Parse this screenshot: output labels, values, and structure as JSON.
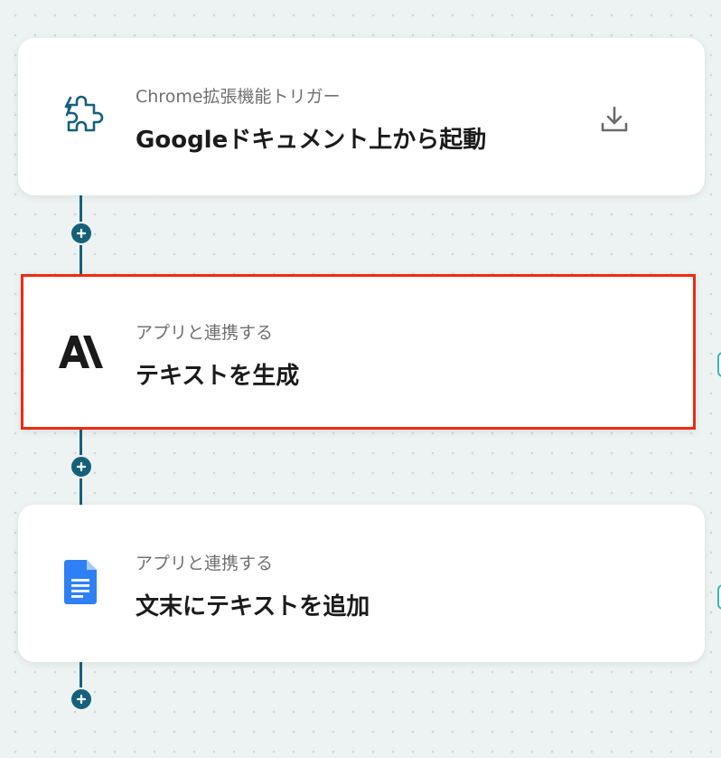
{
  "steps": [
    {
      "subtitle": "Chrome拡張機能トリガー",
      "title": "Googleドキュメント上から起動",
      "icon": "puzzle-icon",
      "action_icon": "download-icon"
    },
    {
      "subtitle": "アプリと連携する",
      "title": "テキストを生成",
      "icon": "anthropic-logo-icon",
      "selected": true
    },
    {
      "subtitle": "アプリと連携する",
      "title": "文末にテキストを追加",
      "icon": "google-docs-icon"
    }
  ],
  "colors": {
    "canvas_background": "#edf3f2",
    "connector": "#17607a",
    "selection_border": "#ee2b12",
    "puzzle_icon": "#17607a",
    "google_docs_blue": "#2f80f4",
    "side_handle": "#3bb7a5"
  }
}
